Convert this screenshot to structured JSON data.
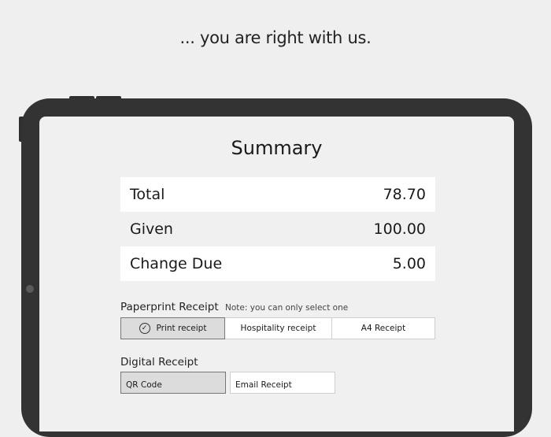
{
  "tagline": "... you are right with us.",
  "summary": {
    "title": "Summary",
    "rows": [
      {
        "label": "Total",
        "value": "78.70"
      },
      {
        "label": "Given",
        "value": "100.00"
      },
      {
        "label": "Change Due",
        "value": "5.00"
      }
    ]
  },
  "paperprint": {
    "label": "Paperprint Receipt",
    "note": "Note: you can only select one",
    "options": [
      {
        "label": "Print receipt",
        "selected": true,
        "icon": "check-circle-icon"
      },
      {
        "label": "Hospitality receipt",
        "selected": false
      },
      {
        "label": "A4 Receipt",
        "selected": false
      }
    ]
  },
  "digital": {
    "label": "Digital Receipt",
    "options": [
      {
        "label": "QR Code",
        "selected": true
      },
      {
        "label": "Email Receipt",
        "selected": false
      }
    ]
  },
  "colors": {
    "background": "#efefef",
    "device": "#333333",
    "screen": "#f0f0f0",
    "selected": "#dcdcdc"
  }
}
